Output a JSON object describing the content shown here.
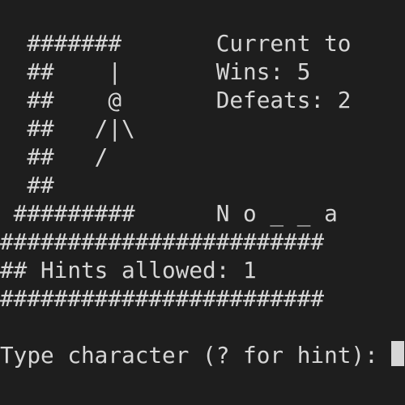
{
  "terminal": {
    "lines": [
      "",
      "  #######       Current to",
      "  ##    |       Wins: 5",
      "  ##    @       Defeats: 2",
      "  ##   /|\\",
      "  ##   /",
      "  ##",
      " #########      N o _ _ a",
      "########################",
      "## Hints allowed: 1",
      "########################",
      "",
      "Type character (? for hint): "
    ]
  },
  "colors": {
    "background": "#1e1e1e",
    "text": "#d6d6d6",
    "cursor": "#d6d6d6"
  }
}
